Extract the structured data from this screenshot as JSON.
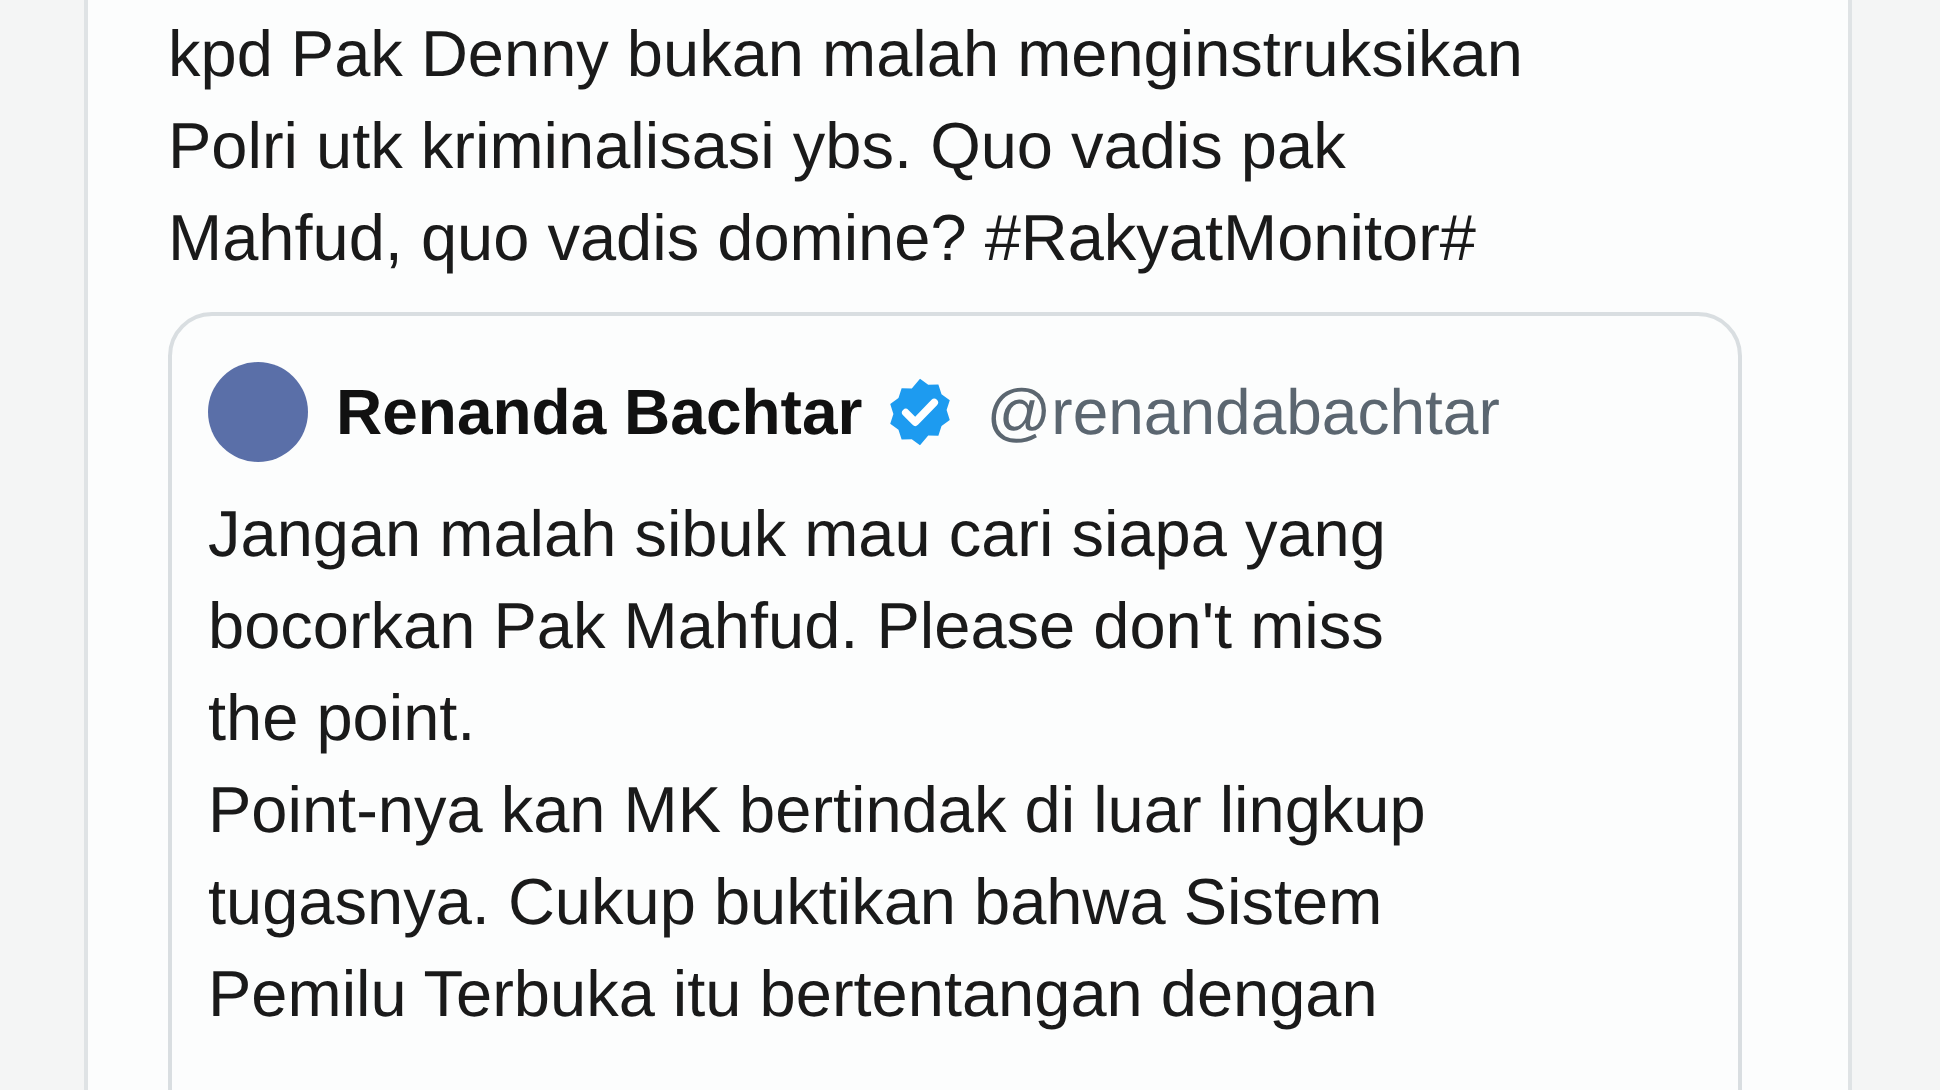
{
  "tweet": {
    "text_lines": [
      "kpd Pak Denny bukan malah menginstruksikan",
      "Polri utk kriminalisasi ybs. Quo vadis pak",
      "Mahfud, quo vadis domine? #RakyatMonitor#"
    ],
    "quoted_tweet": {
      "name": "Renanda Bachtar",
      "verified": true,
      "handle": "@renandabachtar",
      "text_lines": [
        "Jangan malah sibuk mau cari siapa yang",
        "bocorkan Pak Mahfud. Please don't miss",
        "the point.",
        "Point-nya kan MK bertindak di luar lingkup",
        "tugasnya. Cukup buktikan bahwa Sistem",
        "Pemilu Terbuka itu bertentangan dengan"
      ]
    }
  }
}
